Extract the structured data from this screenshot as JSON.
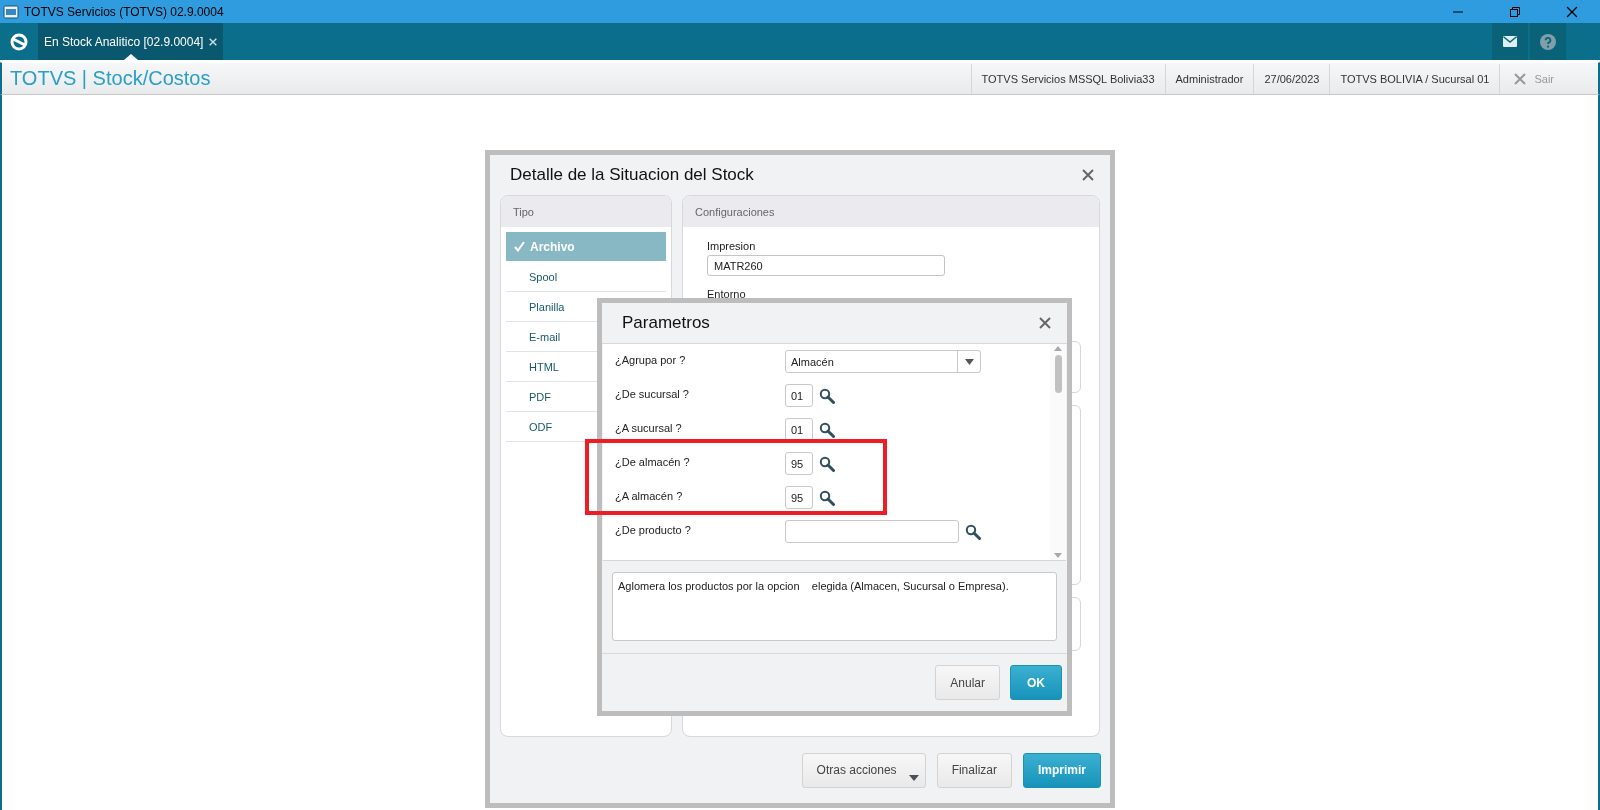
{
  "window": {
    "title": "TOTVS Servicios (TOTVS) 02.9.0004"
  },
  "tabs": [
    {
      "label": "En Stock Analitico [02.9.0004]",
      "selected": true
    }
  ],
  "header": {
    "title": "TOTVS | Stock/Costos",
    "info": [
      "TOTVS Servicios MSSQL Bolivia33",
      "Administrador",
      "27/06/2023",
      "TOTVS BOLIVIA / Sucursal 01"
    ],
    "exit": {
      "label": "Sair",
      "disabled": true
    }
  },
  "dialog": {
    "title": "Detalle de la Situacion del Stock",
    "tipo": {
      "heading": "Tipo",
      "items": [
        {
          "label": "Archivo",
          "selected": true
        },
        {
          "label": "Spool",
          "selected": false
        },
        {
          "label": "Planilla",
          "selected": false
        },
        {
          "label": "E-mail",
          "selected": false
        },
        {
          "label": "HTML",
          "selected": false
        },
        {
          "label": "PDF",
          "selected": false
        },
        {
          "label": "ODF",
          "selected": false
        }
      ]
    },
    "config": {
      "heading": "Configuraciones",
      "fields": [
        {
          "label": "Impresion",
          "value": "MATR260"
        }
      ],
      "section_label": "Entorno"
    },
    "buttons": [
      {
        "label": "Otras acciones",
        "kind": "menu"
      },
      {
        "label": "Finalizar",
        "kind": "default"
      },
      {
        "label": "Imprimir",
        "kind": "primary"
      }
    ]
  },
  "params": {
    "title": "Parametros",
    "rows": [
      {
        "label": "¿Agrupa por ?",
        "kind": "select",
        "value": "Almacén",
        "highlighted": false
      },
      {
        "label": "¿De sucursal ?",
        "kind": "lookup",
        "value": "01",
        "highlighted": false
      },
      {
        "label": "¿A sucursal ?",
        "kind": "lookup",
        "value": "01",
        "highlighted": false
      },
      {
        "label": "¿De almacén ?",
        "kind": "lookup",
        "value": "95",
        "highlighted": true
      },
      {
        "label": "¿A almacén ?",
        "kind": "lookup",
        "value": "95",
        "highlighted": true
      },
      {
        "label": "¿De producto ?",
        "kind": "lookup_wide",
        "highlighted": false
      }
    ],
    "description": "Aglomera los productos por la opcion    elegida (Almacen, Sucursal o Empresa).",
    "buttons": [
      {
        "label": "Anular",
        "kind": "default"
      },
      {
        "label": "OK",
        "kind": "primary"
      }
    ]
  }
}
